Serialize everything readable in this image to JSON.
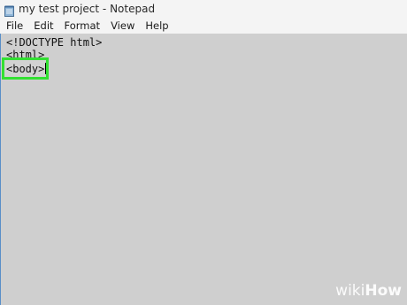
{
  "window": {
    "title": "my test project - Notepad",
    "icon": "notepad-icon"
  },
  "menubar": {
    "items": [
      {
        "label": "File"
      },
      {
        "label": "Edit"
      },
      {
        "label": "Format"
      },
      {
        "label": "View"
      },
      {
        "label": "Help"
      }
    ]
  },
  "editor": {
    "lines": [
      "<!DOCTYPE html>",
      "<html>",
      "<body>"
    ],
    "highlight_color": "#33e033"
  },
  "watermark": {
    "wiki": "wiki",
    "how": "How"
  }
}
